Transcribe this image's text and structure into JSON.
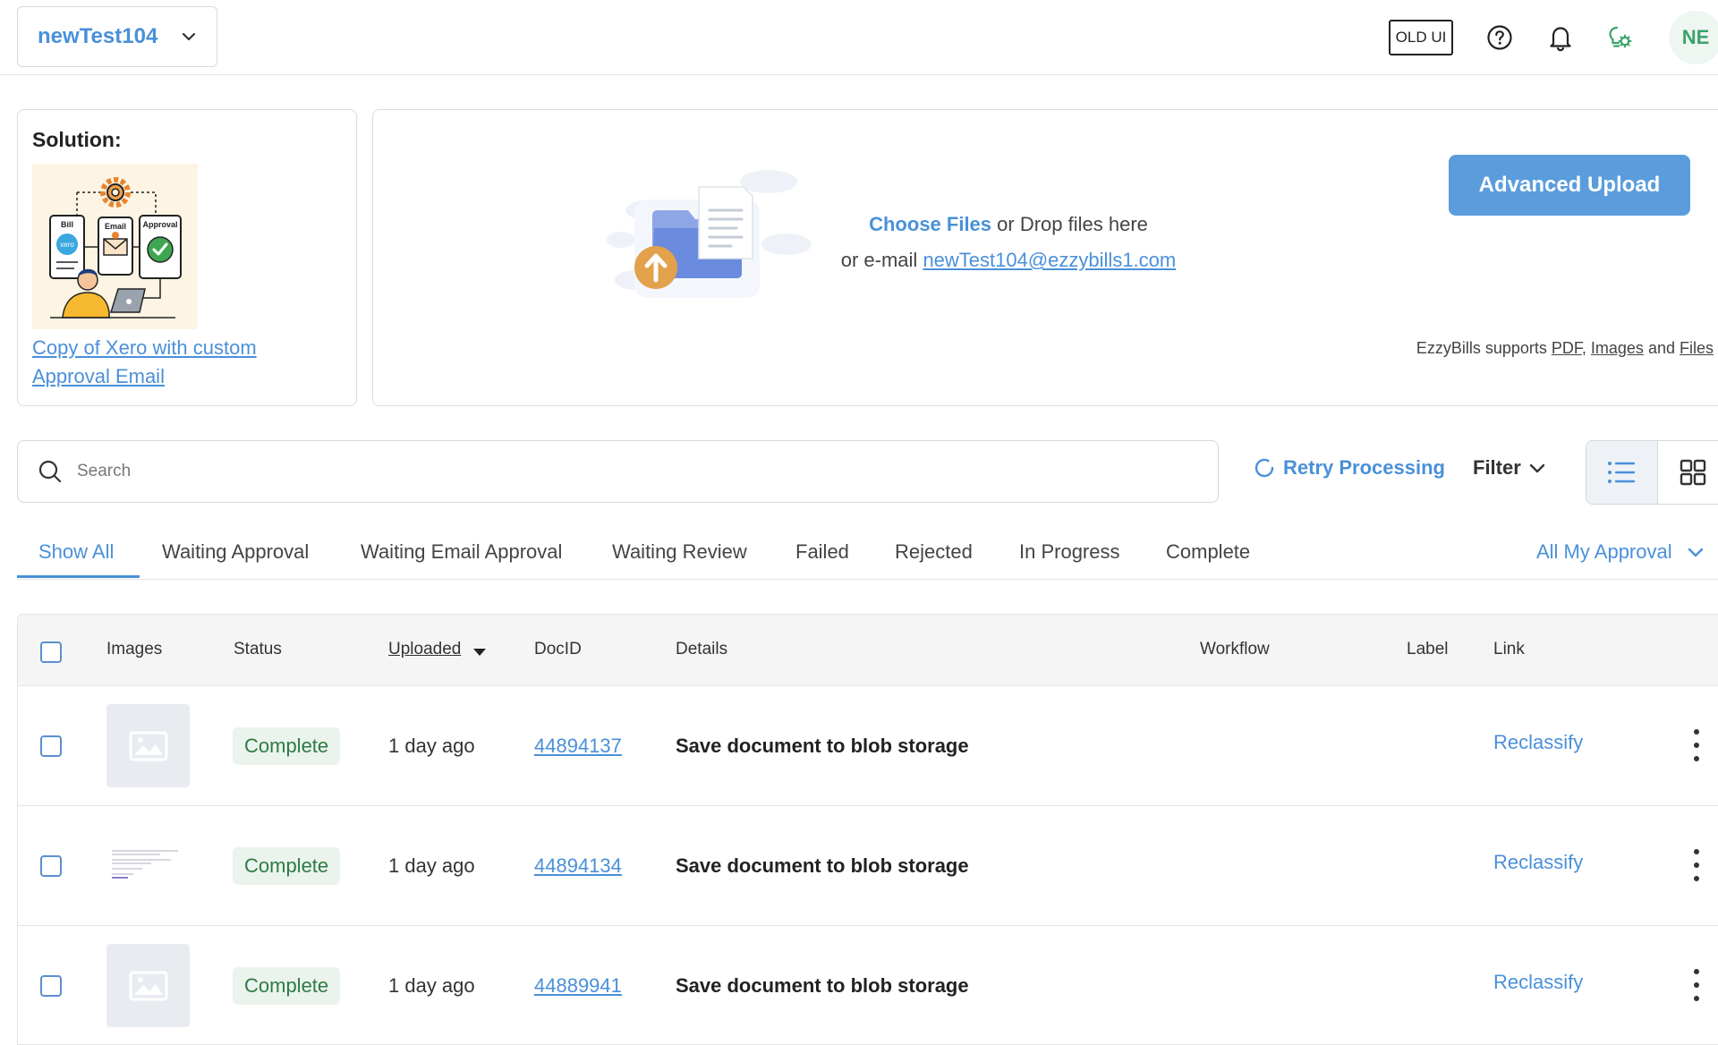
{
  "topbar": {
    "org_name": "newTest104",
    "old_ui_label": "OLD UI",
    "help_icon": "help-circle-icon",
    "bell_icon": "bell-icon",
    "settings_icon": "bulb-gear-icon",
    "avatar_initials": "NE"
  },
  "solution": {
    "title": "Solution:",
    "image_labels": [
      "Bill",
      "xero",
      "Email",
      "Approval"
    ],
    "link_text": "Copy of Xero with custom Approval Email"
  },
  "upload": {
    "choose_files": "Choose Files",
    "drop_text": " or Drop files here",
    "email_prefix": "or e-mail ",
    "email": "newTest104@ezzybills1.com",
    "advanced_button": "Advanced Upload",
    "supports_prefix": "EzzyBills supports ",
    "supports_pdf": "PDF",
    "supports_sep1": ", ",
    "supports_images": "Images",
    "supports_and": " and ",
    "supports_files": "Files"
  },
  "toolbar": {
    "search_placeholder": "Search",
    "retry_label": "Retry Processing",
    "filter_label": "Filter"
  },
  "tabs": [
    {
      "label": "Show All",
      "active": true
    },
    {
      "label": "Waiting Approval",
      "active": false
    },
    {
      "label": "Waiting Email Approval",
      "active": false
    },
    {
      "label": "Waiting Review",
      "active": false
    },
    {
      "label": "Failed",
      "active": false
    },
    {
      "label": "Rejected",
      "active": false
    },
    {
      "label": "In Progress",
      "active": false
    },
    {
      "label": "Complete",
      "active": false
    }
  ],
  "approval_filter": "All My Approval",
  "table": {
    "headers": {
      "images": "Images",
      "status": "Status",
      "uploaded": "Uploaded",
      "docid": "DocID",
      "details": "Details",
      "workflow": "Workflow",
      "label": "Label",
      "link": "Link"
    },
    "rows": [
      {
        "thumb": "placeholder",
        "status": "Complete",
        "uploaded": "1 day ago",
        "docid": "44894137",
        "details": "Save document to blob storage",
        "link": "Reclassify"
      },
      {
        "thumb": "document",
        "status": "Complete",
        "uploaded": "1 day ago",
        "docid": "44894134",
        "details": "Save document to blob storage",
        "link": "Reclassify"
      },
      {
        "thumb": "placeholder",
        "status": "Complete",
        "uploaded": "1 day ago",
        "docid": "44889941",
        "details": "Save document to blob storage",
        "link": "Reclassify"
      }
    ]
  },
  "colors": {
    "accent": "#4a90d9",
    "button": "#5b9ddc",
    "success_bg": "#eaf3ec",
    "success_text": "#2f7a45"
  }
}
